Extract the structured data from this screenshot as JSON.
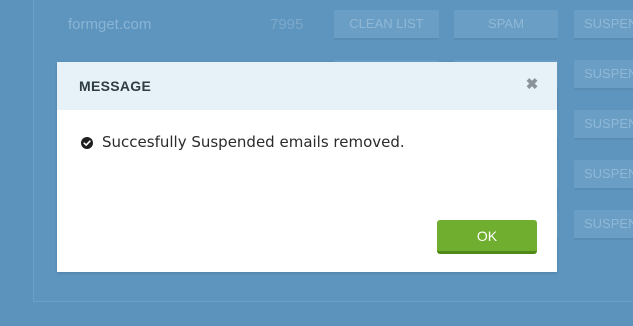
{
  "background": {
    "rows": [
      {
        "domain": "formget.com",
        "count": "7995",
        "clean_label": "CLEAN LIST",
        "spam_label": "SPAM",
        "suspend_label": "SUSPEND"
      },
      {
        "domain": "",
        "count": "",
        "clean_label": "",
        "spam_label": "",
        "suspend_label": "SUSPEND"
      },
      {
        "domain": "",
        "count": "",
        "clean_label": "",
        "spam_label": "",
        "suspend_label": "SUSPEND"
      },
      {
        "domain": "",
        "count": "",
        "clean_label": "",
        "spam_label": "",
        "suspend_label": "SUSPEND"
      },
      {
        "domain": "",
        "count": "",
        "clean_label": "",
        "spam_label": "",
        "suspend_label": "SUSPEND"
      }
    ]
  },
  "modal": {
    "title": "MESSAGE",
    "close_icon": "close-icon",
    "message": "Succesfully Suspended emails removed.",
    "message_icon": "check-circle-icon",
    "ok_label": "OK"
  },
  "colors": {
    "backdrop": "#5b93bd",
    "header_bg": "#e6f2f7",
    "ok_button": "#6fae2e"
  }
}
